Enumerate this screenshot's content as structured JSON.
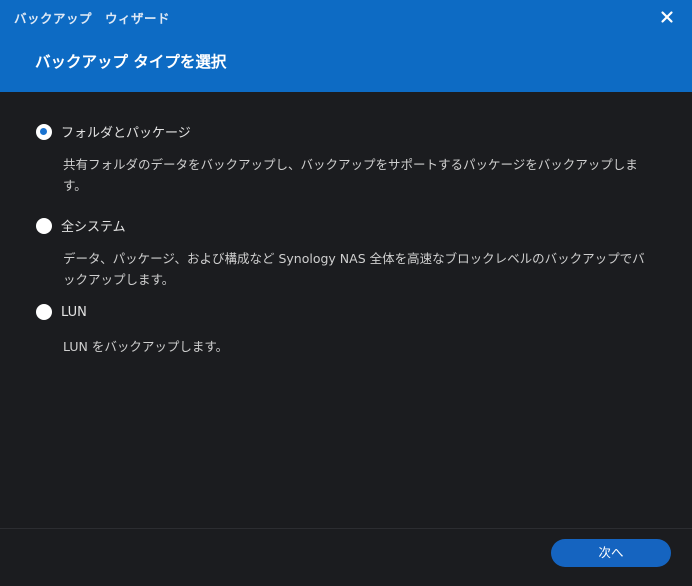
{
  "window": {
    "wizard_title": "バックアップ　ウィザード",
    "page_title": "バックアップ タイプを選択"
  },
  "options": [
    {
      "label": "フォルダとパッケージ",
      "description": "共有フォルダのデータをバックアップし、バックアップをサポートするパッケージをバックアップします。",
      "selected": true
    },
    {
      "label": "全システム",
      "description": "データ、パッケージ、および構成など Synology NAS 全体を高速なブロックレベルのバックアップでバックアップします。",
      "selected": false
    },
    {
      "label": "LUN",
      "description": "LUN をバックアップします。",
      "selected": false
    }
  ],
  "footer": {
    "next_label": "次へ"
  },
  "colors": {
    "header_bg": "#0d6bc4",
    "body_bg": "#1b1c1f",
    "accent": "#1a73d0",
    "button_bg": "#1564c0"
  },
  "icons": {
    "close": "close-icon"
  }
}
